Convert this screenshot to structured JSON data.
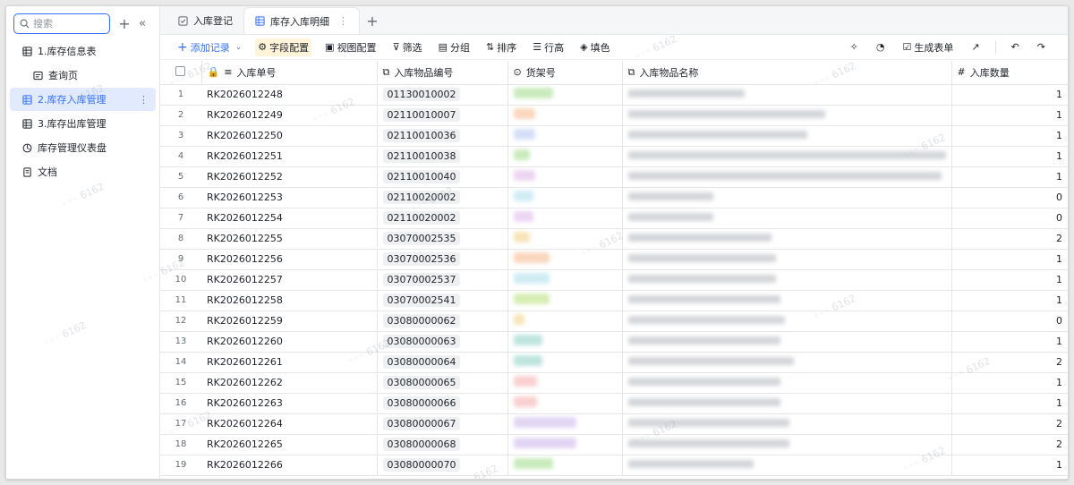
{
  "sidebar": {
    "search_placeholder": "搜索",
    "items": [
      {
        "label": "1.库存信息表",
        "icon": "table-icon",
        "sub": false,
        "active": false
      },
      {
        "label": "查询页",
        "icon": "form-icon",
        "sub": true,
        "active": false
      },
      {
        "label": "2.库存入库管理",
        "icon": "table-icon",
        "sub": false,
        "active": true
      },
      {
        "label": "3.库存出库管理",
        "icon": "table-icon",
        "sub": false,
        "active": false
      },
      {
        "label": "库存管理仪表盘",
        "icon": "dashboard-icon",
        "sub": false,
        "active": false
      },
      {
        "label": "文档",
        "icon": "doc-icon",
        "sub": false,
        "active": false
      }
    ]
  },
  "tabs": [
    {
      "label": "入库登记",
      "icon": "form-icon",
      "active": false
    },
    {
      "label": "库存入库明细",
      "icon": "grid-icon",
      "active": true
    }
  ],
  "toolbar": {
    "add_record": "添加记录",
    "field_config": "字段配置",
    "view_config": "视图配置",
    "filter": "筛选",
    "group": "分组",
    "sort": "排序",
    "row_height": "行高",
    "fill_color": "填色",
    "generate_form": "生成表单"
  },
  "table": {
    "headers": {
      "order_no": "入库单号",
      "item_code": "入库物品编号",
      "shelf": "货架号",
      "item_name": "入库物品名称",
      "quantity": "入库数量"
    },
    "rows": [
      {
        "n": "1",
        "order": "RK2026012248",
        "code": "01130010002",
        "qty": "1",
        "shelf_color": "#b7e4a6",
        "shelf_w": 44,
        "name_w": 130
      },
      {
        "n": "2",
        "order": "RK2026012249",
        "code": "02110010007",
        "qty": "1",
        "shelf_color": "#f8c9a8",
        "shelf_w": 24,
        "name_w": 220
      },
      {
        "n": "3",
        "order": "RK2026012250",
        "code": "02110010036",
        "qty": "1",
        "shelf_color": "#c6d4f5",
        "shelf_w": 24,
        "name_w": 200
      },
      {
        "n": "4",
        "order": "RK2026012251",
        "code": "02110010038",
        "qty": "1",
        "shelf_color": "#b7e4a6",
        "shelf_w": 18,
        "name_w": 355
      },
      {
        "n": "5",
        "order": "RK2026012252",
        "code": "02110010040",
        "qty": "1",
        "shelf_color": "#e6c8ef",
        "shelf_w": 24,
        "name_w": 350
      },
      {
        "n": "6",
        "order": "RK2026012253",
        "code": "02110020002",
        "qty": "0",
        "shelf_color": "#bfe6f0",
        "shelf_w": 22,
        "name_w": 95
      },
      {
        "n": "7",
        "order": "RK2026012254",
        "code": "02110020002",
        "qty": "0",
        "shelf_color": "#e6c8ef",
        "shelf_w": 22,
        "name_w": 95
      },
      {
        "n": "8",
        "order": "RK2026012255",
        "code": "03070002535",
        "qty": "2",
        "shelf_color": "#f5dca0",
        "shelf_w": 18,
        "name_w": 160
      },
      {
        "n": "9",
        "order": "RK2026012256",
        "code": "03070002536",
        "qty": "1",
        "shelf_color": "#f8c9a8",
        "shelf_w": 40,
        "name_w": 165
      },
      {
        "n": "10",
        "order": "RK2026012257",
        "code": "03070002537",
        "qty": "1",
        "shelf_color": "#bfe6f0",
        "shelf_w": 40,
        "name_w": 165
      },
      {
        "n": "11",
        "order": "RK2026012258",
        "code": "03070002541",
        "qty": "1",
        "shelf_color": "#c9e89a",
        "shelf_w": 40,
        "name_w": 170
      },
      {
        "n": "12",
        "order": "RK2026012259",
        "code": "03080000062",
        "qty": "0",
        "shelf_color": "#f5dca0",
        "shelf_w": 12,
        "name_w": 175
      },
      {
        "n": "13",
        "order": "RK2026012260",
        "code": "03080000063",
        "qty": "1",
        "shelf_color": "#a9dcd3",
        "shelf_w": 32,
        "name_w": 170
      },
      {
        "n": "14",
        "order": "RK2026012261",
        "code": "03080000064",
        "qty": "2",
        "shelf_color": "#a9dcd3",
        "shelf_w": 32,
        "name_w": 185
      },
      {
        "n": "15",
        "order": "RK2026012262",
        "code": "03080000065",
        "qty": "1",
        "shelf_color": "#f8c0c0",
        "shelf_w": 26,
        "name_w": 170
      },
      {
        "n": "16",
        "order": "RK2026012263",
        "code": "03080000066",
        "qty": "1",
        "shelf_color": "#f8c0c0",
        "shelf_w": 26,
        "name_w": 170
      },
      {
        "n": "17",
        "order": "RK2026012264",
        "code": "03080000067",
        "qty": "2",
        "shelf_color": "#d9c8f0",
        "shelf_w": 70,
        "name_w": 180
      },
      {
        "n": "18",
        "order": "RK2026012265",
        "code": "03080000068",
        "qty": "2",
        "shelf_color": "#d9c8f0",
        "shelf_w": 70,
        "name_w": 180
      },
      {
        "n": "19",
        "order": "RK2026012266",
        "code": "03080000070",
        "qty": "1",
        "shelf_color": "#b7e4a6",
        "shelf_w": 44,
        "name_w": 140
      }
    ]
  },
  "colors": {
    "accent": "#3370ff",
    "active_bg": "#e1eaff"
  }
}
